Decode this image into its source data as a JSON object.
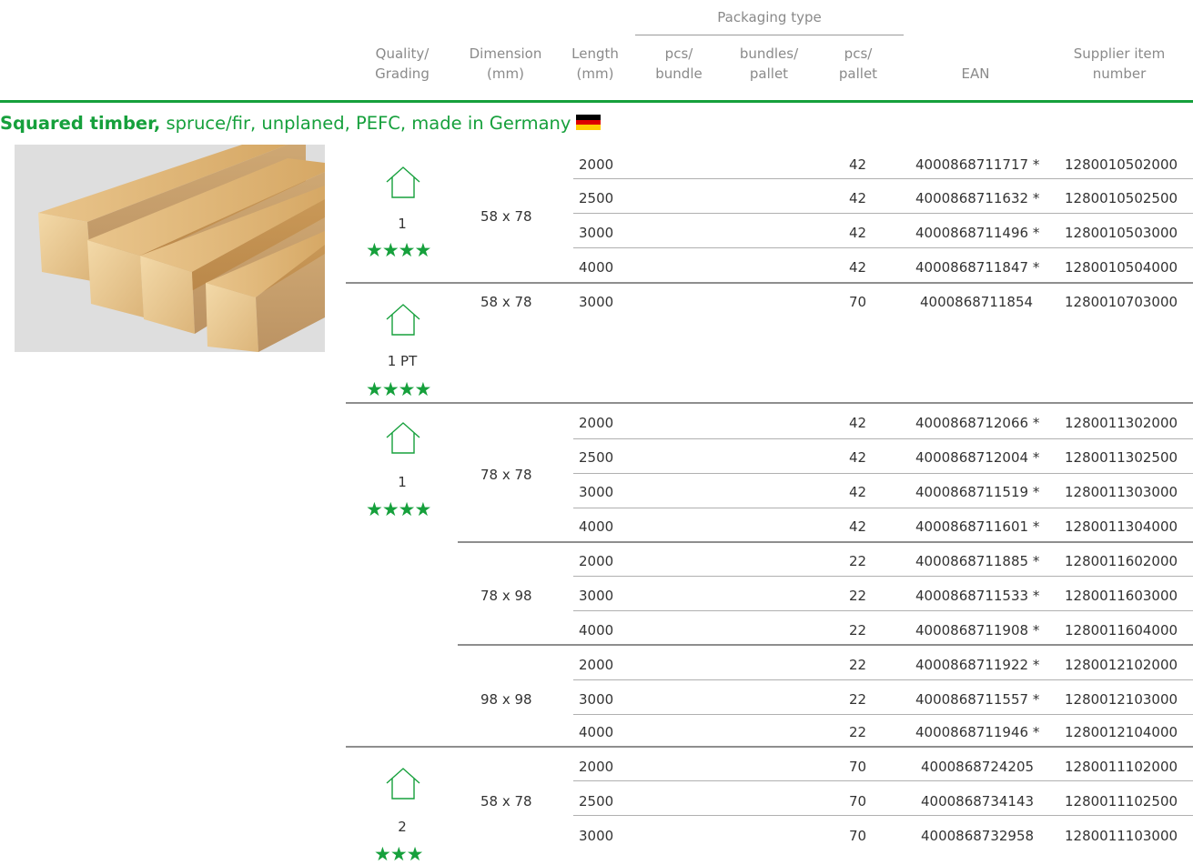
{
  "header": {
    "packaging_type": "Packaging type",
    "quality": "Quality/\nGrading",
    "dimension": "Dimension\n(mm)",
    "length": "Length\n(mm)",
    "pcs_bundle": "pcs/\nbundle",
    "bundles_pallet": "bundles/\npallet",
    "pcs_pallet": "pcs/\npallet",
    "ean": "EAN",
    "supplier": "Supplier item\nnumber"
  },
  "section": {
    "title_bold": "Squared timber,",
    "title_rest": " spruce/fir, unplaned, PEFC, made in Germany",
    "flag": "germany-flag",
    "image": "squared-timber-photo"
  },
  "groups": [
    {
      "grade": "1",
      "stars": "★★★★",
      "icon": "house-icon"
    },
    {
      "grade": "1 PT",
      "stars": "★★★★",
      "icon": "house-icon"
    },
    {
      "grade": "1",
      "stars": "★★★★",
      "icon": "house-icon"
    },
    {
      "grade": "2",
      "stars": "★★★",
      "icon": "house-icon"
    }
  ],
  "dimensions": [
    "58 x 78",
    "58 x 78",
    "78 x 78",
    "78 x 98",
    "98 x 98",
    "58 x 78"
  ],
  "rows": [
    {
      "length": "2000",
      "pcs_pallet": "42",
      "ean": "4000868711717 *",
      "supplier": "1280010502000"
    },
    {
      "length": "2500",
      "pcs_pallet": "42",
      "ean": "4000868711632 *",
      "supplier": "1280010502500"
    },
    {
      "length": "3000",
      "pcs_pallet": "42",
      "ean": "4000868711496 *",
      "supplier": "1280010503000"
    },
    {
      "length": "4000",
      "pcs_pallet": "42",
      "ean": "4000868711847 *",
      "supplier": "1280010504000"
    },
    {
      "length": "3000",
      "pcs_pallet": "70",
      "ean": "4000868711854",
      "supplier": "1280010703000"
    },
    {
      "length": "2000",
      "pcs_pallet": "42",
      "ean": "4000868712066 *",
      "supplier": "1280011302000"
    },
    {
      "length": "2500",
      "pcs_pallet": "42",
      "ean": "4000868712004 *",
      "supplier": "1280011302500"
    },
    {
      "length": "3000",
      "pcs_pallet": "42",
      "ean": "4000868711519 *",
      "supplier": "1280011303000"
    },
    {
      "length": "4000",
      "pcs_pallet": "42",
      "ean": "4000868711601 *",
      "supplier": "1280011304000"
    },
    {
      "length": "2000",
      "pcs_pallet": "22",
      "ean": "4000868711885 *",
      "supplier": "1280011602000"
    },
    {
      "length": "3000",
      "pcs_pallet": "22",
      "ean": "4000868711533 *",
      "supplier": "1280011603000"
    },
    {
      "length": "4000",
      "pcs_pallet": "22",
      "ean": "4000868711908 *",
      "supplier": "1280011604000"
    },
    {
      "length": "2000",
      "pcs_pallet": "22",
      "ean": "4000868711922 *",
      "supplier": "1280012102000"
    },
    {
      "length": "3000",
      "pcs_pallet": "22",
      "ean": "4000868711557 *",
      "supplier": "1280012103000"
    },
    {
      "length": "4000",
      "pcs_pallet": "22",
      "ean": "4000868711946 *",
      "supplier": "1280012104000"
    },
    {
      "length": "2000",
      "pcs_pallet": "70",
      "ean": "4000868724205",
      "supplier": "1280011102000"
    },
    {
      "length": "2500",
      "pcs_pallet": "70",
      "ean": "4000868734143",
      "supplier": "1280011102500"
    },
    {
      "length": "3000",
      "pcs_pallet": "70",
      "ean": "4000868732958",
      "supplier": "1280011103000"
    }
  ],
  "colors": {
    "accent": "#16a03c",
    "rule": "#8e8e8e"
  }
}
